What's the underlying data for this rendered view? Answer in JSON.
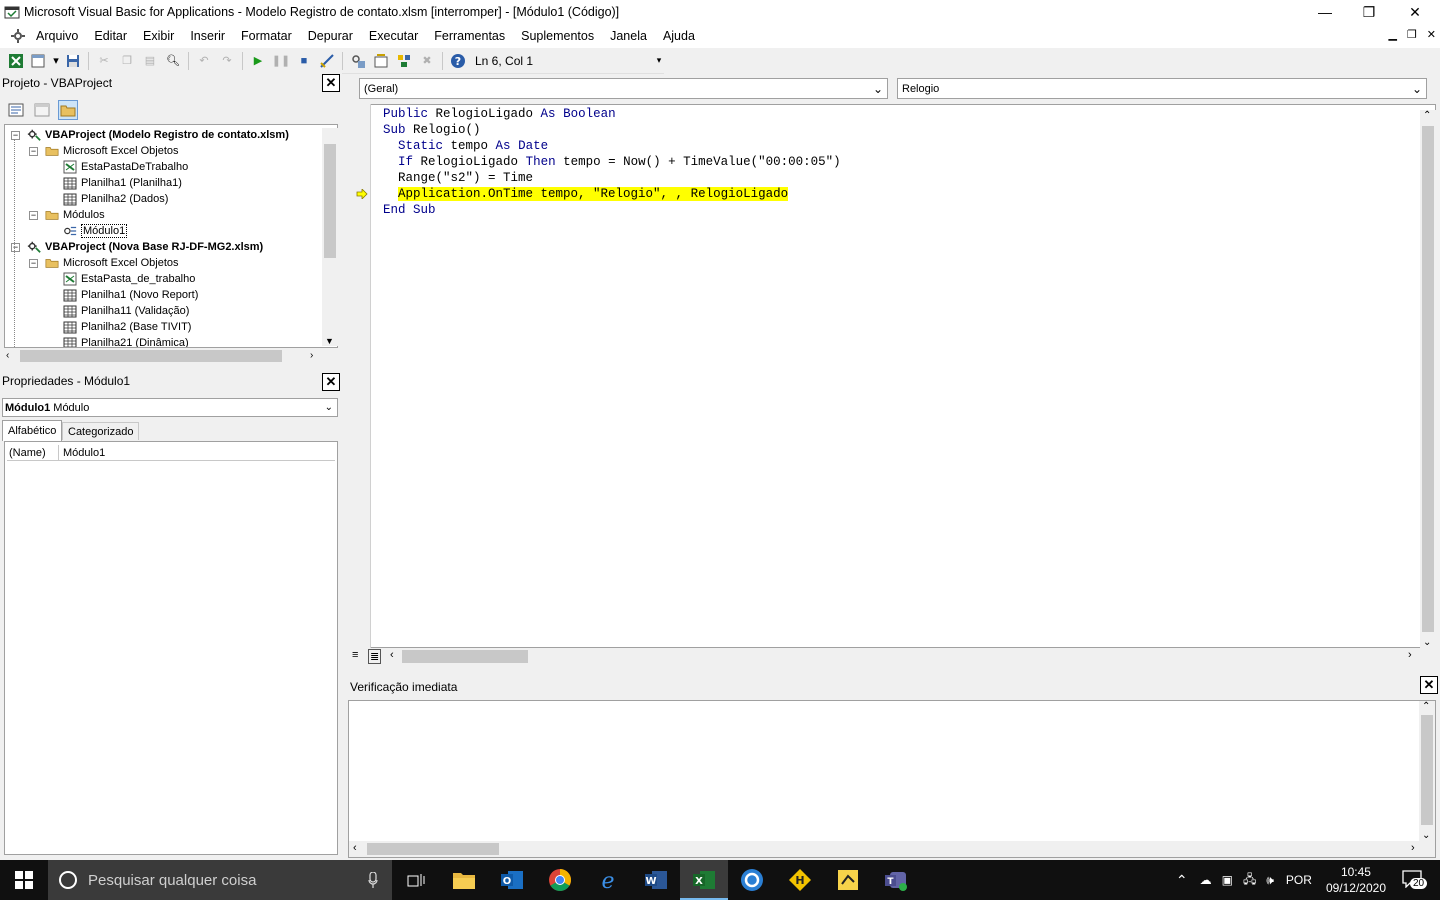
{
  "window": {
    "title": "Microsoft Visual Basic for Applications - Modelo Registro de contato.xlsm [interromper] - [Módulo1 (Código)]",
    "minimize": "—",
    "restore": "❐",
    "close": "✕"
  },
  "menu": [
    "Arquivo",
    "Editar",
    "Exibir",
    "Inserir",
    "Formatar",
    "Depurar",
    "Executar",
    "Ferramentas",
    "Suplementos",
    "Janela",
    "Ajuda"
  ],
  "toolbar": {
    "position": "Ln 6, Col 1"
  },
  "project": {
    "title": "Projeto - VBAProject",
    "tree": [
      {
        "label": "VBAProject (Modelo Registro de contato.xlsm)",
        "level": 0,
        "bold": true,
        "icon": "vbaproject-icon"
      },
      {
        "label": "Microsoft Excel Objetos",
        "level": 1,
        "icon": "folder-icon"
      },
      {
        "label": "EstaPastaDeTrabalho",
        "level": 2,
        "icon": "workbook-icon"
      },
      {
        "label": "Planilha1 (Planilha1)",
        "level": 2,
        "icon": "sheet-icon"
      },
      {
        "label": "Planilha2 (Dados)",
        "level": 2,
        "icon": "sheet-icon"
      },
      {
        "label": "Módulos",
        "level": 1,
        "icon": "folder-icon"
      },
      {
        "label": "Módulo1",
        "level": 2,
        "icon": "module-icon"
      },
      {
        "label": "VBAProject (Nova Base RJ-DF-MG2.xlsm)",
        "level": 0,
        "bold": true,
        "icon": "vbaproject-icon"
      },
      {
        "label": "Microsoft Excel Objetos",
        "level": 1,
        "icon": "folder-icon"
      },
      {
        "label": "EstaPasta_de_trabalho",
        "level": 2,
        "icon": "workbook-icon"
      },
      {
        "label": "Planilha1 (Novo Report)",
        "level": 2,
        "icon": "sheet-icon"
      },
      {
        "label": "Planilha11 (Validação)",
        "level": 2,
        "icon": "sheet-icon"
      },
      {
        "label": "Planilha2 (Base TIVIT)",
        "level": 2,
        "icon": "sheet-icon"
      },
      {
        "label": "Planilha21 (Dinâmica)",
        "level": 2,
        "icon": "sheet-icon"
      }
    ]
  },
  "properties": {
    "title": "Propriedades - Módulo1",
    "object_name": "Módulo1",
    "object_type": "Módulo",
    "tabs": [
      "Alfabético",
      "Categorizado"
    ],
    "rows": [
      {
        "name": "(Name)",
        "value": "Módulo1"
      }
    ]
  },
  "code": {
    "object_combo": "(Geral)",
    "proc_combo": "Relogio",
    "lines": [
      "Public RelogioLigado As Boolean",
      "Sub Relogio()",
      "  Static tempo As Date",
      "  If RelogioLigado Then tempo = Now() + TimeValue(\"00:00:05\")",
      "  Range(\"s2\") = Time",
      "  Application.OnTime tempo, \"Relogio\", , RelogioLigado",
      "End Sub"
    ],
    "current_line": 6
  },
  "immediate": {
    "title": "Verificação imediata"
  },
  "taskbar": {
    "search_placeholder": "Pesquisar qualquer coisa",
    "time": "10:45",
    "date": "09/12/2020",
    "lang": "POR",
    "notifications": "20"
  }
}
